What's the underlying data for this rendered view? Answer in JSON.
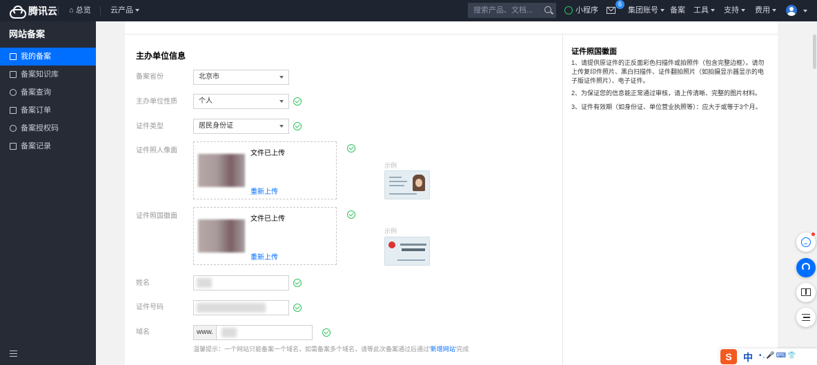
{
  "topbar": {
    "brand": "腾讯云",
    "overview": "总览",
    "products": "云产品",
    "search_placeholder": "搜索产品、文档...",
    "miniprogram": "小程序",
    "mail_badge": "6",
    "group_account": "集团账号",
    "beian": "备案",
    "tools": "工具",
    "support": "支持",
    "billing": "费用"
  },
  "sidebar": {
    "title": "网站备案",
    "items": [
      {
        "label": "我的备案",
        "active": true
      },
      {
        "label": "备案知识库"
      },
      {
        "label": "备案查询"
      },
      {
        "label": "备案订单"
      },
      {
        "label": "备案授权码"
      },
      {
        "label": "备案记录"
      }
    ]
  },
  "form": {
    "section_title": "主办单位信息",
    "province_label": "备案省份",
    "province_value": "北京市",
    "nature_label": "主办单位性质",
    "nature_value": "个人",
    "cert_type_label": "证件类型",
    "cert_type_value": "居民身份证",
    "portrait_label": "证件照人像面",
    "emblem_label": "证件照国徽面",
    "uploaded_text": "文件已上传",
    "reupload_text": "重新上传",
    "sample_text": "示例",
    "name_label": "姓名",
    "cert_no_label": "证件号码",
    "domain_label": "域名",
    "domain_prefix": "www.",
    "tip_text": "温馨提示：一个网站只能备案一个域名，如需备案多个域名，请等此次备案通过后通过",
    "tip_link": "'新增网站'",
    "tip_suffix": "完成"
  },
  "help": {
    "title": "证件照国徽面",
    "p1": "1、请提供原证件的正反面彩色扫描件或拍照件（包含完整边框）。请勿上传复印件照片、黑白扫描件、证件翻拍照片（如拍摄显示器显示的电子版证件照片）、电子证件。",
    "p2": "2、为保证您的信息能正常通过审核，请上传清晰、完整的图片材料。",
    "p3": "3、证件有效期（如身份证、单位营业执照等）：应大于或等于3个月。"
  },
  "ime": {
    "logo": "S",
    "mode": "中",
    "rest": "•,🎤⌨👕"
  },
  "colors": {
    "accent": "#006eff",
    "success": "#2fc25b",
    "topbar_bg": "#1f2431",
    "sidebar_bg": "#262b36"
  }
}
